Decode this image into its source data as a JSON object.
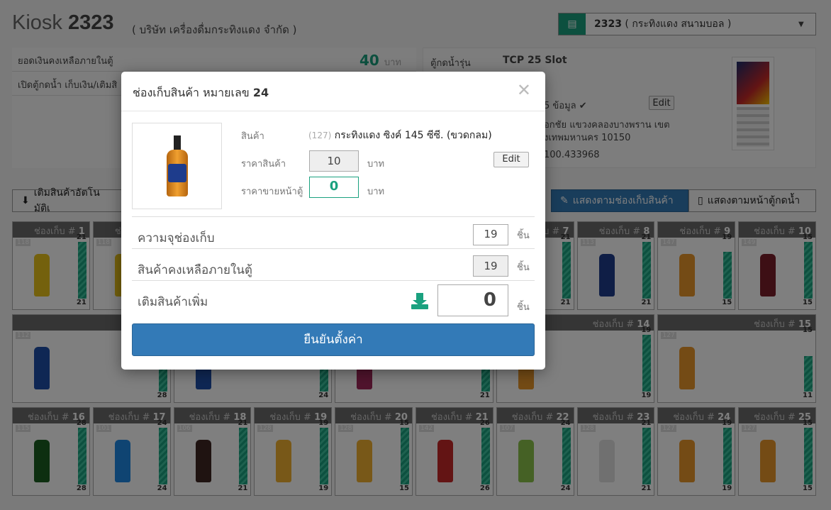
{
  "header": {
    "kiosk_label": "Kiosk",
    "kiosk_id": "2323",
    "company": "( บริษัท เครื่องดื่มกระทิงแดง จำกัด )",
    "selector_id": "2323",
    "selector_name": "( กระทิงแดง สนามบอล )"
  },
  "info": {
    "balance_label": "ยอดเงินคงเหลือภายในตู้",
    "balance_value": "40",
    "balance_unit": "บาท",
    "open_label": "เปิดตู้กดน้ำ เก็บเงิน/เติมสิ",
    "model_label": "ตู้กดน้ำรุ่น",
    "model_value": "TCP 25 Slot",
    "data_label": "5 ข้อมูล ✔",
    "edit_label": "Edit",
    "address1": "อกชัย แขวงคลองบางพราน เขต",
    "address2": "งเทพมหานคร 10150",
    "coord": "100.433968"
  },
  "toolbar": {
    "auto_refill": "เติมสินค้าอัตโนมัติเ",
    "by_slot": "แสดงตามช่องเก็บสินค้า",
    "by_front": "แสดงตามหน้าตู้กดน้ำ"
  },
  "slot_label": "ช่องเก็บ #",
  "slots_row1": [
    {
      "no": "1",
      "code": "118",
      "top": "21",
      "bottom": "21"
    },
    {
      "no": "2",
      "code": "118",
      "top": "",
      "bottom": ""
    },
    {
      "no": "7",
      "code": "",
      "top": "21",
      "bottom": "21"
    },
    {
      "no": "8",
      "code": "113",
      "top": "21",
      "bottom": "21"
    },
    {
      "no": "9",
      "code": "147",
      "top": "19",
      "bottom": "15"
    },
    {
      "no": "10",
      "code": "149",
      "top": "15",
      "bottom": "15"
    }
  ],
  "slots_row2": [
    {
      "no": "11",
      "code": "112",
      "top": "",
      "bottom": "28"
    },
    {
      "no": "12",
      "code": "",
      "top": "",
      "bottom": "24"
    },
    {
      "no": "13",
      "code": "",
      "top": "",
      "bottom": "21"
    },
    {
      "no": "14",
      "code": "129",
      "top": "19",
      "bottom": "19"
    },
    {
      "no": "15",
      "code": "127",
      "top": "15",
      "bottom": "11"
    }
  ],
  "slots_row3": [
    {
      "no": "16",
      "code": "115",
      "top": "28",
      "bottom": "28"
    },
    {
      "no": "17",
      "code": "101",
      "top": "24",
      "bottom": "24"
    },
    {
      "no": "18",
      "code": "106",
      "top": "21",
      "bottom": "21"
    },
    {
      "no": "19",
      "code": "128",
      "top": "19",
      "bottom": "19"
    },
    {
      "no": "20",
      "code": "128",
      "top": "15",
      "bottom": "15"
    },
    {
      "no": "21",
      "code": "142",
      "top": "26",
      "bottom": "26"
    },
    {
      "no": "22",
      "code": "107",
      "top": "24",
      "bottom": "24"
    },
    {
      "no": "23",
      "code": "128",
      "top": "21",
      "bottom": "21"
    },
    {
      "no": "24",
      "code": "127",
      "top": "19",
      "bottom": "19"
    },
    {
      "no": "25",
      "code": "127",
      "top": "15",
      "bottom": "15"
    }
  ],
  "modal": {
    "title_prefix": "ช่องเก็บสินค้า หมายเลข",
    "title_no": "24",
    "product_label": "สินค้า",
    "product_code": "(127)",
    "product_name": "กระทิงแดง ซิงค์ 145 ซีซี. (ขวดกลม)",
    "price_label": "ราคาสินค้า",
    "price_value": "10",
    "price_unit": "บาท",
    "edit_label": "Edit",
    "sell_label": "ราคาขายหน้าตู้",
    "sell_value": "0",
    "sell_unit": "บาท",
    "capacity_label": "ความจุช่องเก็บ",
    "capacity_value": "19",
    "capacity_unit": "ชิ้น",
    "remain_label": "สินค้าคงเหลือภายในตู้",
    "remain_value": "19",
    "remain_unit": "ชิ้น",
    "refill_label": "เติมสินค้าเพิ่ม",
    "refill_value": "0",
    "refill_unit": "ชิ้น",
    "confirm_label": "ยืนยันตั้งค่า"
  }
}
